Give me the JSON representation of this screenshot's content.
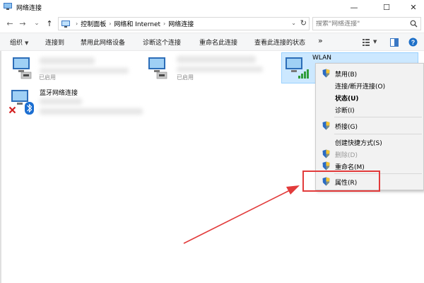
{
  "window": {
    "title": "网络连接",
    "minimize": "—",
    "maximize": "☐",
    "close": "✕"
  },
  "nav": {
    "back": "←",
    "forward": "→",
    "recent": "⌄",
    "up": "↑"
  },
  "address": {
    "crumbs": [
      "控制面板",
      "网络和 Internet",
      "网络连接"
    ],
    "separator": "›",
    "dropdown": "⌄",
    "refresh": "↻"
  },
  "search": {
    "placeholder": "搜索\"网络连接\""
  },
  "commands": {
    "organize": "组织",
    "connect_to": "连接到",
    "disable_device": "禁用此网络设备",
    "diagnose": "诊断这个连接",
    "rename": "重命名此连接",
    "view_status": "查看此连接的状态",
    "more": "»"
  },
  "connections": [
    {
      "name": "",
      "status": "已启用"
    },
    {
      "name": "",
      "status": "已启用"
    },
    {
      "name": "WLAN",
      "status": ""
    },
    {
      "name": "蓝牙网络连接",
      "status": ""
    }
  ],
  "context_menu": {
    "items": [
      {
        "label": "禁用(B)"
      },
      {
        "label": "连接/断开连接(O)"
      },
      {
        "label": "状态(U)"
      },
      {
        "label": "诊断(I)"
      },
      {
        "label": "桥接(G)"
      },
      {
        "label": "创建快捷方式(S)"
      },
      {
        "label": "删除(D)"
      },
      {
        "label": "重命名(M)"
      },
      {
        "label": "属性(R)"
      }
    ]
  },
  "colors": {
    "annotation": "#e23b3b",
    "selection": "#cce8ff",
    "menu_bg": "#f2f2f2"
  }
}
